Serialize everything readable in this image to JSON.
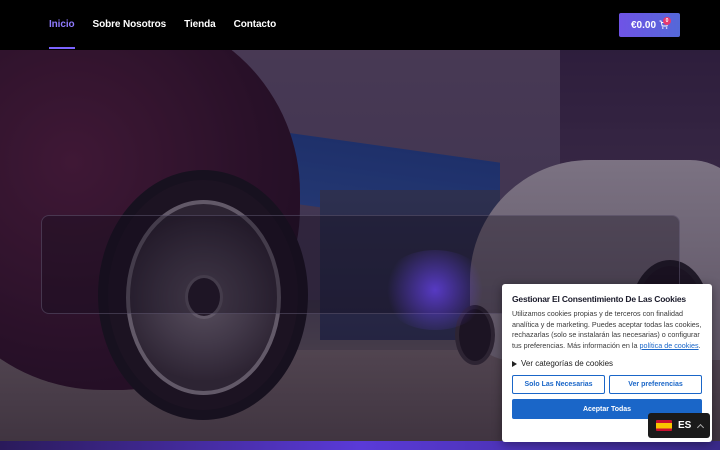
{
  "nav": {
    "items": [
      {
        "label": "Inicio",
        "active": true
      },
      {
        "label": "Sobre Nosotros",
        "active": false
      },
      {
        "label": "Tienda",
        "active": false
      },
      {
        "label": "Contacto",
        "active": false
      }
    ]
  },
  "cart": {
    "amount": "€0.00",
    "count": "0",
    "icon": "cart-icon",
    "accent": "#6f53e6"
  },
  "cookie": {
    "title": "Gestionar El Consentimiento De Las Cookies",
    "text": "Utilizamos cookies propias y de terceros con finalidad analítica y de marketing. Puedes aceptar todas las cookies, rechazarlas (solo se instalarán las necesarias) o configurar tus preferencias. Más información en la ",
    "policy_link": "política de cookies",
    "text_end": ".",
    "categories_toggle": "Ver categorías de cookies",
    "btn_necessary": "Solo Las Necesarias",
    "btn_preferences": "Ver preferencias",
    "btn_accept_all": "Aceptar Todas",
    "accent": "#1a66c8"
  },
  "language": {
    "code": "ES",
    "flag": "spain-flag-icon"
  }
}
